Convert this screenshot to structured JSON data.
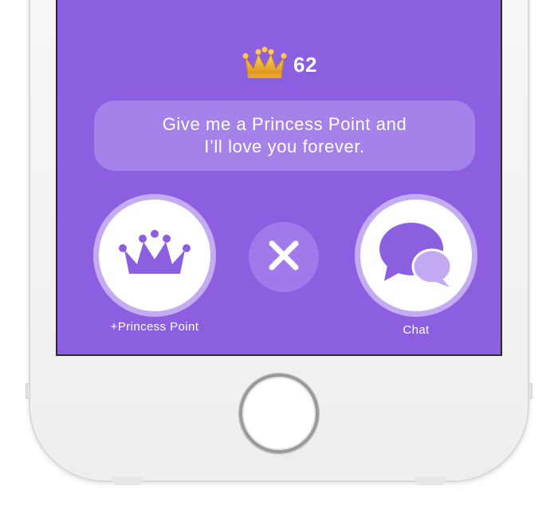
{
  "points": {
    "icon": "gold-crown-icon",
    "value": "62"
  },
  "message": {
    "line1": "Give me a Princess Point and",
    "line2": "I’ll love you forever."
  },
  "actions": {
    "princess_point": {
      "icon": "purple-crown-icon",
      "label": "+Princess Point"
    },
    "dismiss": {
      "icon": "close-icon"
    },
    "chat": {
      "icon": "chat-bubbles-icon",
      "label": "Chat"
    }
  },
  "colors": {
    "screen_background": "#8b5fe0",
    "bubble_background": "#a482ea",
    "crown_gold": "#f2b63a",
    "icon_purple": "#8b5fe0",
    "ring": "#c4acf2"
  }
}
